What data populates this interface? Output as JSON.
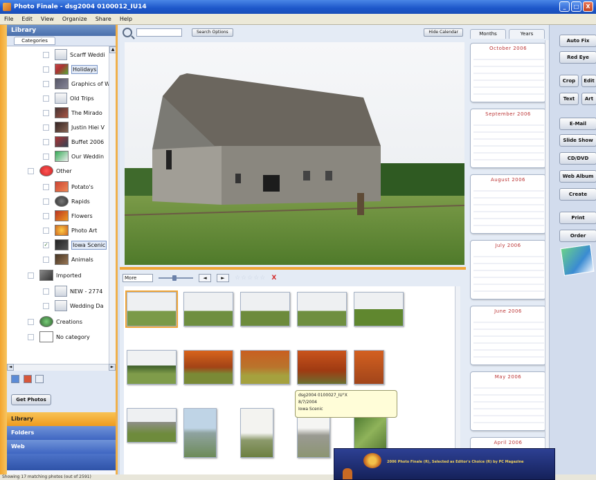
{
  "window": {
    "title": "Photo Finale - dsg2004 0100012_IU14",
    "controls": [
      "_",
      "□",
      "X"
    ]
  },
  "menu": [
    "File",
    "Edit",
    "View",
    "Organize",
    "Share",
    "Help"
  ],
  "sidebar": {
    "header": "Library",
    "category_tab": "Categories",
    "tree": [
      {
        "label": "Scarff Weddi",
        "checked": false
      },
      {
        "label": "Holidays",
        "checked": false
      },
      {
        "label": "Graphics of W",
        "checked": false
      },
      {
        "label": "Old Trips",
        "checked": false
      },
      {
        "label": "The Mirado",
        "checked": false
      },
      {
        "label": "Justin Hiei V",
        "checked": false
      },
      {
        "label": "Buffet 2006",
        "checked": false
      },
      {
        "label": "Our Weddin",
        "checked": false
      },
      {
        "label": "Other",
        "checked": false
      },
      {
        "label": "Potato's",
        "checked": false
      },
      {
        "label": "Rapids",
        "checked": false
      },
      {
        "label": "Flowers",
        "checked": false
      },
      {
        "label": "Photo Art",
        "checked": false
      },
      {
        "label": "Iowa Scenic",
        "checked": true
      },
      {
        "label": "Animals",
        "checked": false
      },
      {
        "label": "Imported",
        "checked": false
      },
      {
        "label": "NEW - 2774",
        "checked": false
      },
      {
        "label": "Wedding Da",
        "checked": false
      },
      {
        "label": "Creations",
        "checked": false
      },
      {
        "label": "No category",
        "checked": false
      }
    ],
    "get_photos": "Get Photos",
    "bottom_tabs": [
      "Library",
      "Folders",
      "Web"
    ]
  },
  "toolbar": {
    "search_placeholder": "",
    "search_button": "Search Options",
    "hide_calendar": "Hide Calendar"
  },
  "filmstrip": {
    "size": "More",
    "prev": "◄",
    "next": "►",
    "stars": "☆☆☆☆☆",
    "delete": "X"
  },
  "tooltip": {
    "line1": "dsg2004 0100027_IU°X",
    "line2": "8/7/2004",
    "line3": "Iowa Scenic"
  },
  "calendar": {
    "tabs": [
      "Months",
      "Years"
    ],
    "months": [
      "October 2006",
      "September 2006",
      "August 2006",
      "July 2006",
      "June 2006",
      "May 2006",
      "April 2006"
    ]
  },
  "right_panel": {
    "buttons": [
      "Auto Fix",
      "Red Eye",
      "Crop",
      "Edit",
      "Text",
      "Art",
      "E-Mail",
      "Slide Show",
      "CD/DVD",
      "Web Album",
      "Create",
      "Print",
      "Order"
    ]
  },
  "status": "Showing 17 matching photos (out of 2591)",
  "promo": {
    "text": "2006 Photo Finale (R), Selected as Editor's Choice (R) by PC Magazine"
  },
  "colors": {
    "titlebar": "#1c56c9",
    "accent_orange": "#f0a535",
    "panel_blue": "#e4ebf5",
    "calendar_month_title": "#b33333"
  }
}
